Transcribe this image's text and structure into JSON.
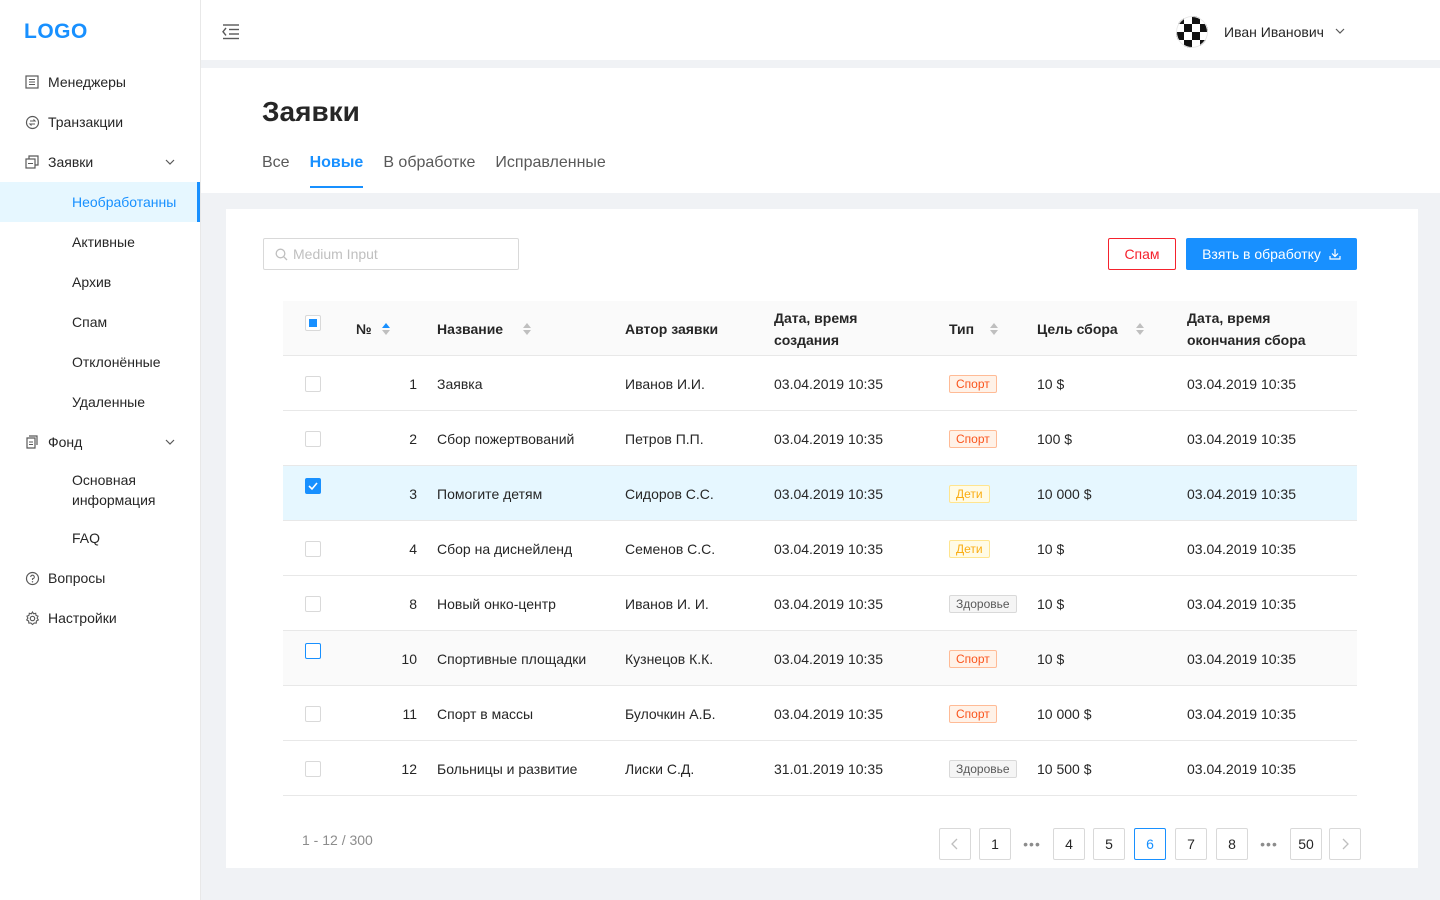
{
  "sidebar": {
    "logo": "LOGO",
    "items": [
      {
        "label": "Менеджеры"
      },
      {
        "label": "Транзакции"
      },
      {
        "label": "Заявки"
      },
      {
        "label": "Фонд"
      },
      {
        "label": "Вопросы"
      },
      {
        "label": "Настройки"
      }
    ],
    "requests_sub": [
      {
        "label": "Необработанны",
        "active": true
      },
      {
        "label": "Активные"
      },
      {
        "label": "Архив"
      },
      {
        "label": "Спам"
      },
      {
        "label": "Отклонённые"
      },
      {
        "label": "Удаленные"
      }
    ],
    "fund_sub": [
      {
        "label": "Основная информация"
      },
      {
        "label": "FAQ"
      }
    ]
  },
  "header": {
    "user_name": "Иван Иванович"
  },
  "page": {
    "title": "Заявки",
    "tabs": [
      {
        "label": "Все"
      },
      {
        "label": "Новые",
        "active": true
      },
      {
        "label": "В обработке"
      },
      {
        "label": "Исправленные"
      }
    ]
  },
  "toolbar": {
    "search_placeholder": "Medium Input",
    "spam_label": "Спам",
    "take_label": "Взять в обработку"
  },
  "table": {
    "columns": {
      "num": "№",
      "name": "Название",
      "author": "Автор заявки",
      "created": "Дата, время создания",
      "type": "Тип",
      "goal": "Цель сбора",
      "end": "Дата, время окончания сбора"
    },
    "rows": [
      {
        "num": "1",
        "name": "Заявка",
        "author": "Иванов И.И.",
        "created": "03.04.2019 10:35",
        "type": "Спорт",
        "goal": "10 $",
        "end": "03.04.2019 10:35"
      },
      {
        "num": "2",
        "name": "Сбор пожертвований",
        "author": "Петров П.П.",
        "created": "03.04.2019 10:35",
        "type": "Спорт",
        "goal": "100 $",
        "end": "03.04.2019 10:35"
      },
      {
        "num": "3",
        "name": "Помогите детям",
        "author": "Сидоров С.С.",
        "created": "03.04.2019 10:35",
        "type": "Дети",
        "goal": "10 000 $",
        "end": "03.04.2019 10:35"
      },
      {
        "num": "4",
        "name": "Сбор на диснейленд",
        "author": "Семенов С.С.",
        "created": "03.04.2019 10:35",
        "type": "Дети",
        "goal": "10 $",
        "end": "03.04.2019 10:35"
      },
      {
        "num": "8",
        "name": "Новый онко-центр",
        "author": "Иванов И. И.",
        "created": "03.04.2019 10:35",
        "type": "Здоровье",
        "goal": "10 $",
        "end": "03.04.2019 10:35"
      },
      {
        "num": "10",
        "name": "Спортивные площадки",
        "author": "Кузнецов К.К.",
        "created": "03.04.2019 10:35",
        "type": "Спорт",
        "goal": "10 $",
        "end": "03.04.2019 10:35"
      },
      {
        "num": "11",
        "name": "Спорт в массы",
        "author": "Булочкин А.Б.",
        "created": "03.04.2019 10:35",
        "type": "Спорт",
        "goal": "10 000 $",
        "end": "03.04.2019 10:35"
      },
      {
        "num": "12",
        "name": "Больницы и развитие",
        "author": "Лиски С.Д.",
        "created": "31.01.2019 10:35",
        "type": "Здоровье",
        "goal": "10 500 $",
        "end": "03.04.2019 10:35"
      }
    ]
  },
  "pagination": {
    "range": "1 - 12 / 300",
    "pages": [
      "1",
      "4",
      "5",
      "6",
      "7",
      "8",
      "50"
    ],
    "current": "6",
    "ellipsis": "•••"
  },
  "colors": {
    "primary": "#1890ff",
    "danger": "#f5222d",
    "selected_row": "#e6f7ff"
  }
}
